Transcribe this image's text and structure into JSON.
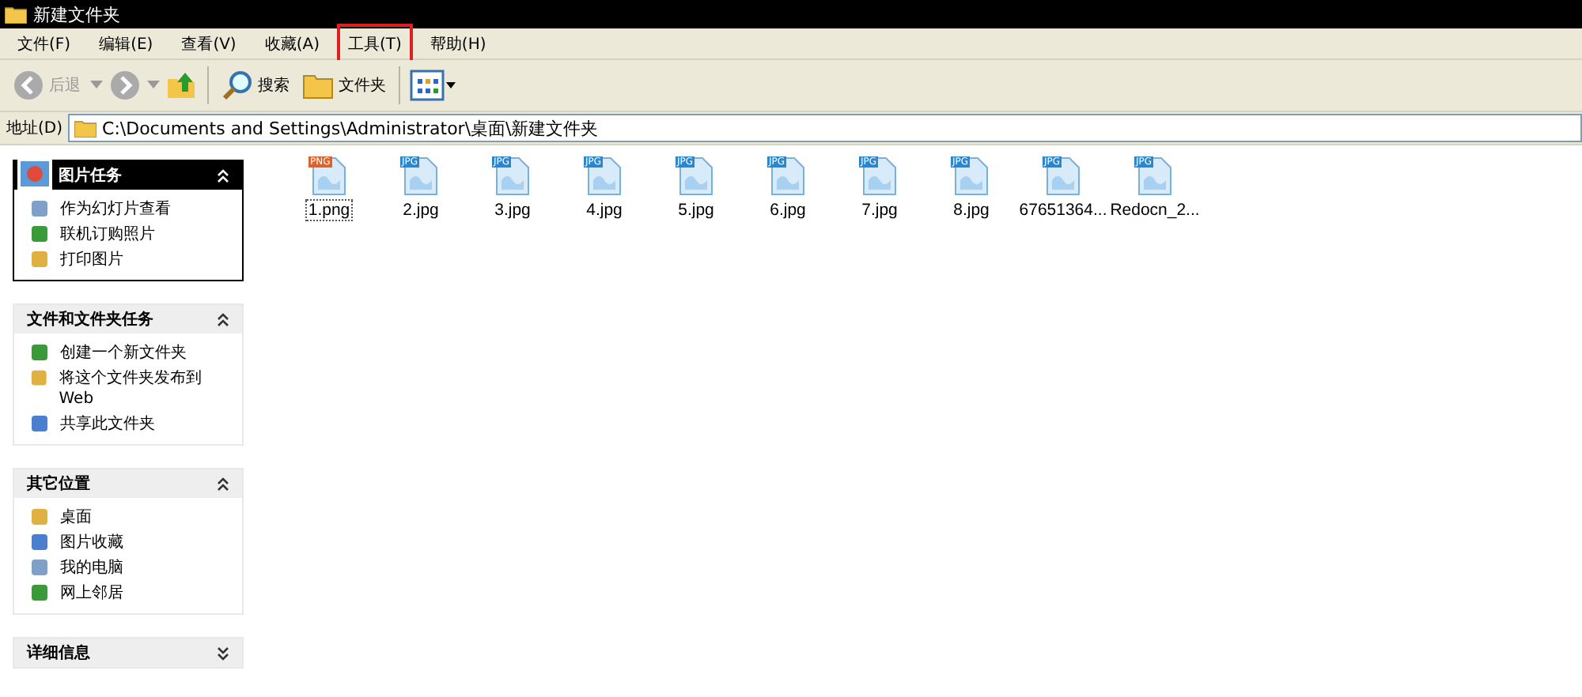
{
  "window": {
    "title": "新建文件夹"
  },
  "menu": [
    {
      "label": "文件(F)",
      "highlighted": false
    },
    {
      "label": "编辑(E)",
      "highlighted": false
    },
    {
      "label": "查看(V)",
      "highlighted": false
    },
    {
      "label": "收藏(A)",
      "highlighted": false
    },
    {
      "label": "工具(T)",
      "highlighted": true
    },
    {
      "label": "帮助(H)",
      "highlighted": false
    }
  ],
  "toolbar": {
    "back": {
      "label": "后退",
      "disabled": true
    },
    "search": "搜索",
    "folders": "文件夹"
  },
  "address": {
    "label": "地址(D)",
    "value": "C:\\Documents and Settings\\Administrator\\桌面\\新建文件夹"
  },
  "panels": [
    {
      "title": "图片任务",
      "kind": "special",
      "expanded": true,
      "items": [
        {
          "label": "作为幻灯片查看"
        },
        {
          "label": "联机订购照片"
        },
        {
          "label": "打印图片"
        }
      ]
    },
    {
      "title": "文件和文件夹任务",
      "kind": "normal",
      "expanded": true,
      "items": [
        {
          "label": "创建一个新文件夹"
        },
        {
          "label": "将这个文件夹发布到 Web"
        },
        {
          "label": "共享此文件夹"
        }
      ]
    },
    {
      "title": "其它位置",
      "kind": "normal",
      "expanded": true,
      "items": [
        {
          "label": "桌面"
        },
        {
          "label": "图片收藏"
        },
        {
          "label": "我的电脑"
        },
        {
          "label": "网上邻居"
        }
      ]
    },
    {
      "title": "详细信息",
      "kind": "normal",
      "expanded": false
    }
  ],
  "files": [
    {
      "name": "1.png",
      "badge": "PNG",
      "focused": true
    },
    {
      "name": "2.jpg",
      "badge": "JPG",
      "focused": false
    },
    {
      "name": "3.jpg",
      "badge": "JPG",
      "focused": false
    },
    {
      "name": "4.jpg",
      "badge": "JPG",
      "focused": false
    },
    {
      "name": "5.jpg",
      "badge": "JPG",
      "focused": false
    },
    {
      "name": "6.jpg",
      "badge": "JPG",
      "focused": false
    },
    {
      "name": "7.jpg",
      "badge": "JPG",
      "focused": false
    },
    {
      "name": "8.jpg",
      "badge": "JPG",
      "focused": false
    },
    {
      "name": "67651364...",
      "badge": "JPG",
      "focused": false
    },
    {
      "name": "Redocn_2...",
      "badge": "JPG",
      "focused": false
    }
  ]
}
